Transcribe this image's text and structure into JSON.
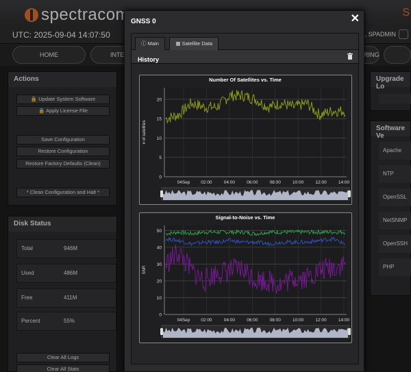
{
  "app": {
    "logo_text": "spectracom",
    "topbar_right": "S",
    "utc": "UTC: 2025-09-04 14:07:50",
    "user": "ME, SPADMIN"
  },
  "nav": {
    "items": [
      "HOME",
      "INTE",
      "RING"
    ]
  },
  "actions": {
    "title": "Actions",
    "buttons": [
      "Update System Software",
      "Apply License File",
      "Save Configuration",
      "Restore Configuration",
      "Restore Factory Defaults (Clean)",
      "* Clean Configuration and Halt *"
    ]
  },
  "disk": {
    "title": "Disk Status",
    "rows": [
      {
        "label": "Total",
        "value": "946M"
      },
      {
        "label": "Used",
        "value": "486M"
      },
      {
        "label": "Free",
        "value": "411M"
      },
      {
        "label": "Percent",
        "value": "55%"
      }
    ],
    "buttons": [
      "Clear All Logs",
      "Clear All Stats"
    ]
  },
  "right": {
    "upgrade_title": "Upgrade Lo",
    "software_title": "Software Ve",
    "items": [
      "Apache",
      "NTP",
      "OpenSSL",
      "NetSNMP",
      "OpenSSH",
      "PHP"
    ]
  },
  "modal": {
    "title": "GNSS 0",
    "close": "✕",
    "tabs": [
      "Main",
      "Satellite Data"
    ],
    "active_tab": 1,
    "section_title": "History"
  },
  "chart_data": [
    {
      "type": "line",
      "title": "Number Of Satellites vs. Time",
      "ylabel": "# of satellites",
      "xlabel": "",
      "ylim": [
        0,
        23
      ],
      "yticks": [
        0,
        5,
        10,
        15,
        20
      ],
      "xticks": [
        "04Sep",
        "02:00",
        "04:00",
        "06:00",
        "08:00",
        "10:00",
        "12:00",
        "14:00"
      ],
      "grid": true,
      "series": [
        {
          "color": "#8c9a1a",
          "x": [
            "00:00",
            "01:00",
            "02:00",
            "03:00",
            "04:00",
            "05:00",
            "06:00",
            "07:00",
            "08:00",
            "09:00",
            "10:00",
            "11:00",
            "12:00",
            "13:00",
            "14:00"
          ],
          "values": [
            15,
            16,
            19,
            18,
            18,
            21,
            21,
            20,
            18,
            19,
            18,
            19,
            16,
            17,
            17
          ]
        }
      ]
    },
    {
      "type": "line",
      "title": "Signal-to-Noise vs. Time",
      "ylabel": "SNR",
      "xlabel": "",
      "ylim": [
        0,
        53
      ],
      "yticks": [
        0,
        10,
        20,
        30,
        40,
        50
      ],
      "xticks": [
        "04Sep",
        "02:00",
        "04:00",
        "06:00",
        "08:00",
        "10:00",
        "12:00",
        "14:00"
      ],
      "grid": true,
      "series": [
        {
          "color": "#2e9e4a",
          "x": [
            "00:00",
            "01:00",
            "02:00",
            "03:00",
            "04:00",
            "05:00",
            "06:00",
            "07:00",
            "08:00",
            "09:00",
            "10:00",
            "11:00",
            "12:00",
            "13:00",
            "14:00"
          ],
          "values": [
            48,
            49,
            48,
            49,
            49,
            49,
            49,
            48,
            49,
            49,
            49,
            49,
            49,
            49,
            49
          ]
        },
        {
          "color": "#2c52b8",
          "x": [
            "00:00",
            "01:00",
            "02:00",
            "03:00",
            "04:00",
            "05:00",
            "06:00",
            "07:00",
            "08:00",
            "09:00",
            "10:00",
            "11:00",
            "12:00",
            "13:00",
            "14:00"
          ],
          "values": [
            45,
            44,
            42,
            43,
            43,
            44,
            43,
            43,
            42,
            43,
            43,
            43,
            44,
            45,
            42
          ]
        },
        {
          "color": "#7a1a9a",
          "x": [
            "00:00",
            "01:00",
            "02:00",
            "03:00",
            "04:00",
            "05:00",
            "06:00",
            "07:00",
            "08:00",
            "09:00",
            "10:00",
            "11:00",
            "12:00",
            "13:00",
            "14:00"
          ],
          "values": [
            30,
            37,
            26,
            20,
            25,
            26,
            27,
            21,
            20,
            18,
            22,
            22,
            26,
            28,
            30
          ]
        }
      ]
    }
  ]
}
